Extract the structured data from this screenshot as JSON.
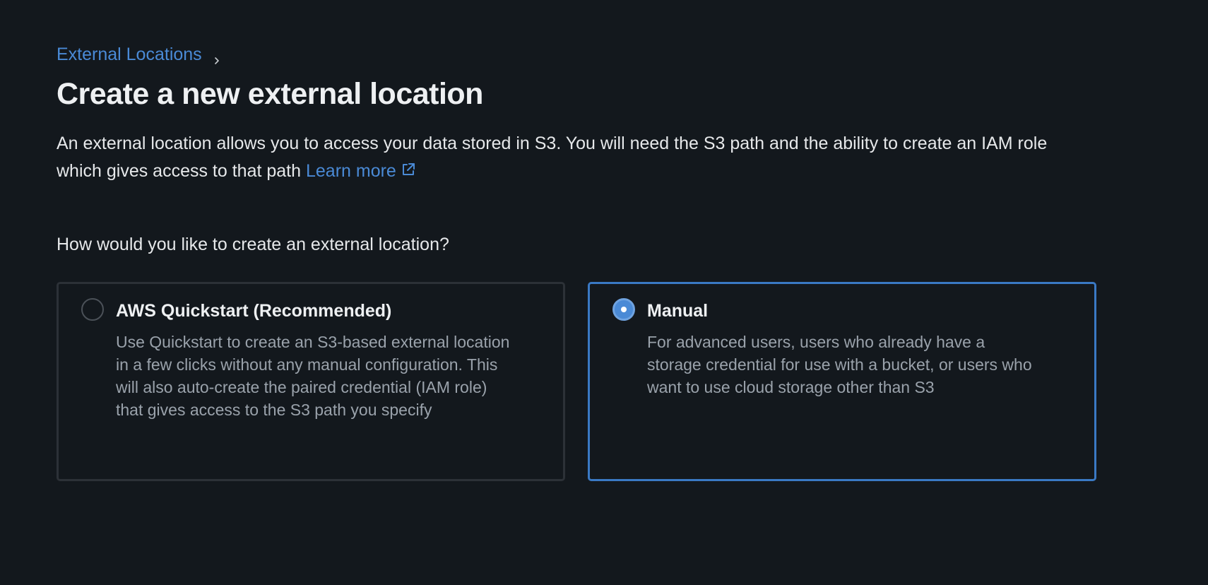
{
  "breadcrumb": {
    "link_label": "External Locations"
  },
  "page": {
    "title": "Create a new external location",
    "description": "An external location allows you to access your data stored in S3. You will need the S3 path and the ability to create an IAM role which gives access to that path",
    "learn_more_label": "Learn more"
  },
  "question": "How would you like to create an external location?",
  "options": [
    {
      "title": "AWS Quickstart (Recommended)",
      "description": "Use Quickstart to create an S3-based external location in a few clicks without any manual configuration. This will also auto-create the paired credential (IAM role) that gives access to the S3 path you specify",
      "selected": false
    },
    {
      "title": "Manual",
      "description": "For advanced users, users who already have a storage credential for use with a bucket, or users who want to use cloud storage other than S3",
      "selected": true
    }
  ],
  "colors": {
    "background": "#13181d",
    "link": "#4a8ad6",
    "selected_border": "#3a79c4",
    "unselected_border": "#2c3137",
    "muted_text": "#9aa2ab"
  },
  "icons": {
    "breadcrumb_separator": "chevron-right-icon",
    "learn_more": "external-link-icon"
  }
}
